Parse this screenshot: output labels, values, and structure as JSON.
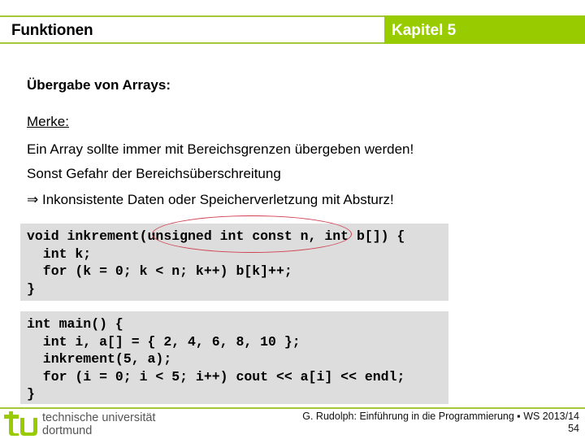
{
  "header": {
    "title": "Funktionen",
    "chapter": "Kapitel 5",
    "accent_color": "#99cc00"
  },
  "content": {
    "heading": "Übergabe von Arrays:",
    "merke_label": "Merke:",
    "lines": [
      "Ein Array sollte immer mit Bereichsgrenzen übergeben werden!",
      "Sonst Gefahr der Bereichsüberschreitung",
      "⇒ Inkonsistente Daten oder Speicherverletzung mit Absturz!"
    ]
  },
  "code_blocks": [
    {
      "code": "void inkrement(unsigned int const n, int b[]) {\n  int k;\n  for (k = 0; k < n; k++) b[k]++;\n}"
    },
    {
      "code": "int main() {\n  int i, a[] = { 2, 4, 6, 8, 10 };\n  inkrement(5, a);\n  for (i = 0; i < 5; i++) cout << a[i] << endl;\n}"
    }
  ],
  "highlight": {
    "text": "(unsigned int const n,",
    "color": "#d04050"
  },
  "footer": {
    "university_line1": "technische universität",
    "university_line2": "dortmund",
    "credit": "G. Rudolph: Einführung in die Programmierung ▪ WS 2013/14",
    "page_number": "54"
  }
}
